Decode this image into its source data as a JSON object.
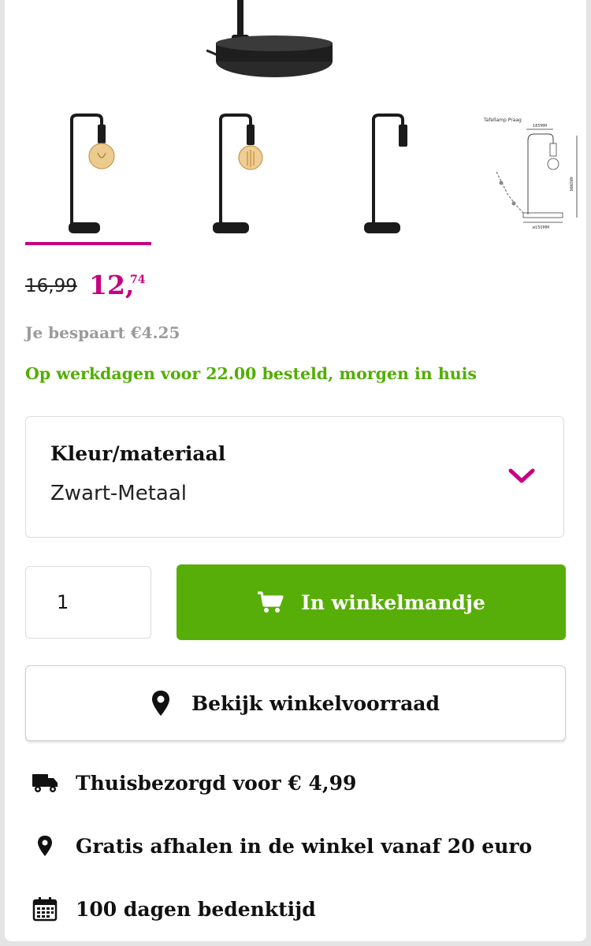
{
  "gallery": {
    "hero_image": "lamp-base-photo",
    "thumbnails": [
      {
        "name": "lamp-with-bulb-photo-1",
        "active": true
      },
      {
        "name": "lamp-with-bulb-photo-2",
        "active": false
      },
      {
        "name": "lamp-without-bulb-photo",
        "active": false
      },
      {
        "name": "dimension-drawing"
      }
    ],
    "drawing": {
      "title": "Tafellamp Praag",
      "width_label": "185MM",
      "height_label": "480MM",
      "base_label": "ø150MM"
    }
  },
  "price": {
    "old": "16,99",
    "new_main": "12,",
    "new_cents": "74",
    "savings": "Je bespaart €4.25",
    "delivery_note": "Op werkdagen voor 22.00 besteld, morgen in huis"
  },
  "variant": {
    "label": "Kleur/materiaal",
    "value": "Zwart-Metaal",
    "icon": "chevron-down-icon"
  },
  "quantity": {
    "value": "1"
  },
  "cart_button": {
    "label": "In winkelmandje",
    "icon": "cart-icon"
  },
  "store_button": {
    "label": "Bekijk winkelvoorraad",
    "icon": "location-pin-icon"
  },
  "usps": [
    {
      "icon": "delivery-truck-icon",
      "text": "Thuisbezorgd voor € 4,99"
    },
    {
      "icon": "location-pin-icon",
      "text": "Gratis afhalen in de winkel vanaf 20 euro"
    },
    {
      "icon": "calendar-icon",
      "text": "100 dagen bedenktijd"
    }
  ],
  "colors": {
    "accent": "#c6007e",
    "green": "#58ae08",
    "green_text": "#52ae00",
    "muted": "#9a9a9a"
  }
}
